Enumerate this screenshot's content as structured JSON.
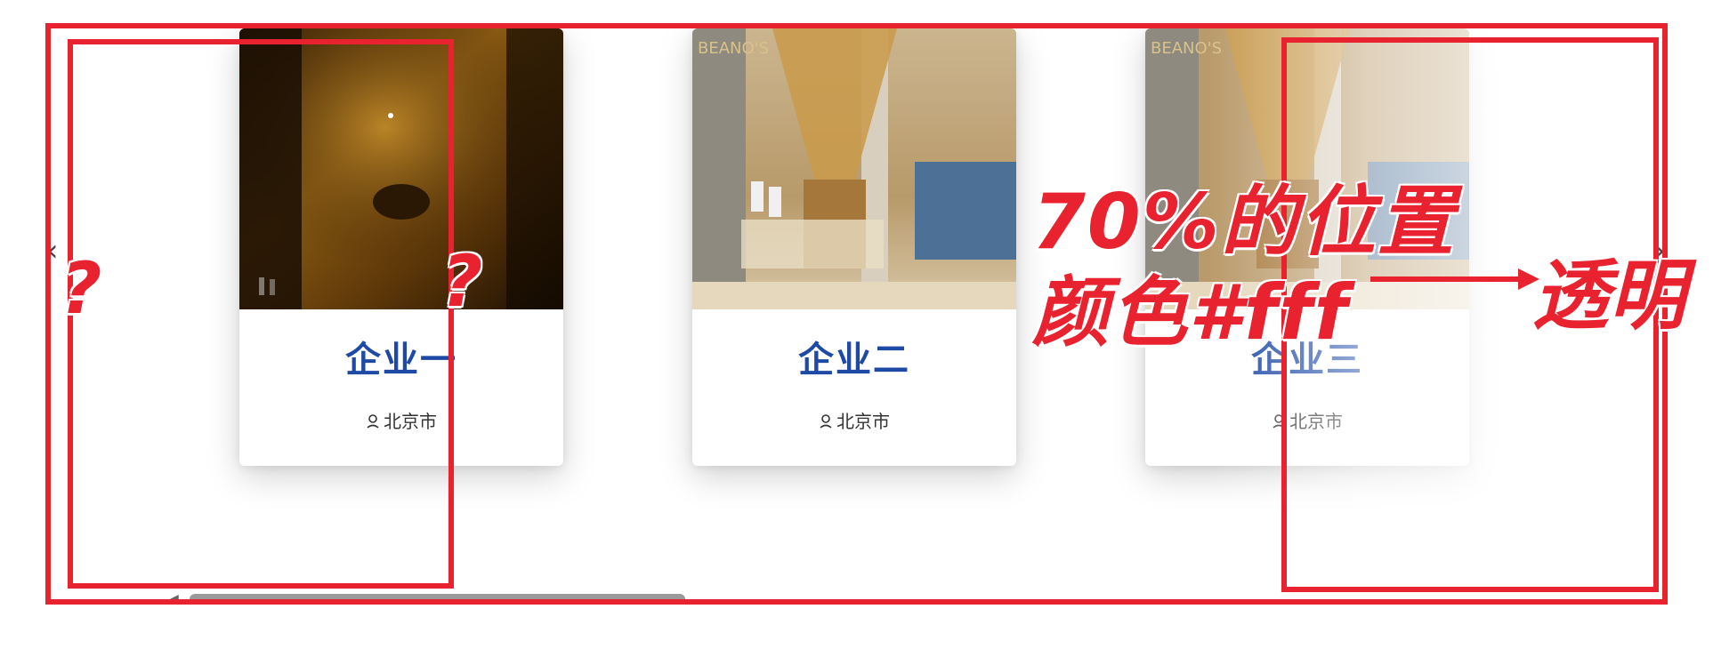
{
  "cards": [
    {
      "title": "企业一",
      "location": "北京市"
    },
    {
      "title": "企业二",
      "location": "北京市"
    },
    {
      "title": "企业三",
      "location": "北京市"
    }
  ],
  "nav": {
    "prev_glyph": "‹",
    "next_glyph": "›"
  },
  "annotations": {
    "question_left": "?",
    "question_right": "?",
    "note_line1": "70%的位置",
    "note_line2": "颜色#fff",
    "transparent": "透明"
  },
  "colors": {
    "annotation": "#e8222e",
    "title": "#1e4aa6"
  }
}
